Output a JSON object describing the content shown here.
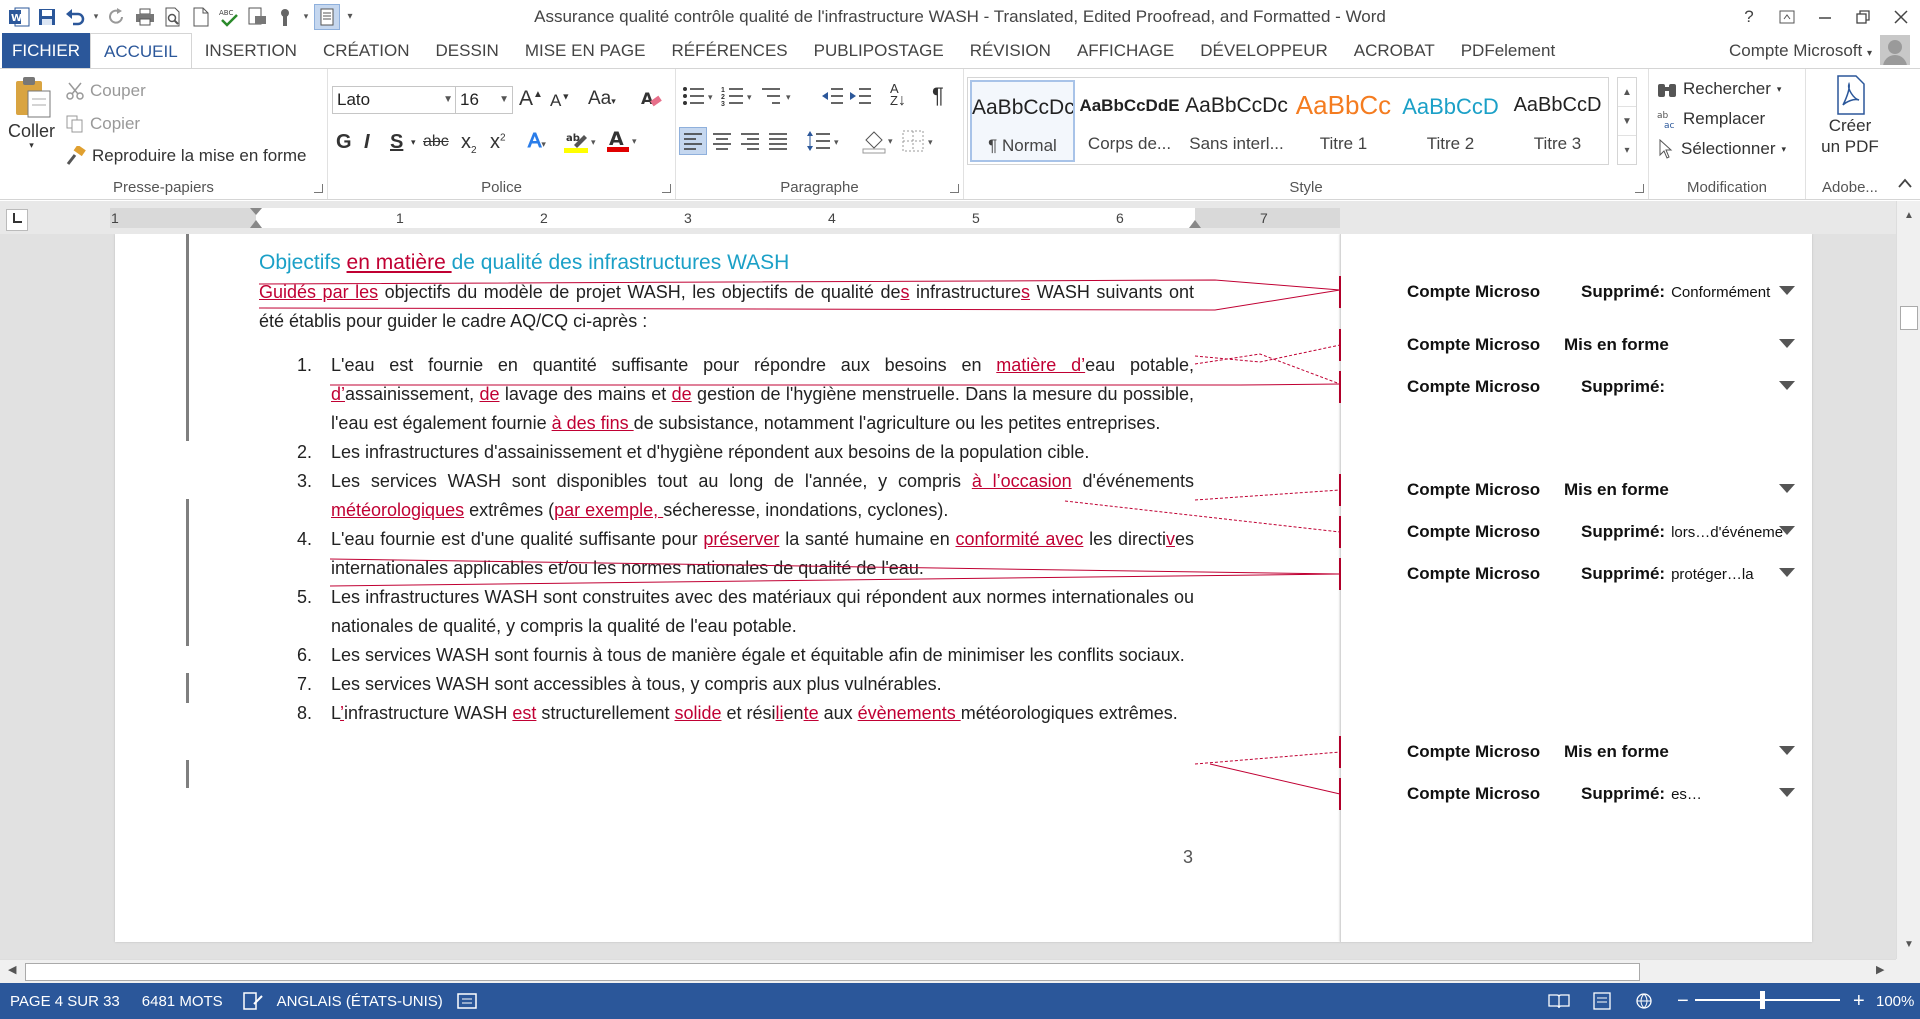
{
  "window": {
    "title": "Assurance qualité  contrôle qualité de l'infrastructure WASH - Translated, Edited Proofread, and Formatted - Word",
    "help": "?",
    "accent": "#2b579a"
  },
  "tabs": {
    "file": "FICHIER",
    "items": [
      "ACCUEIL",
      "INSERTION",
      "CRÉATION",
      "DESSIN",
      "MISE EN PAGE",
      "RÉFÉRENCES",
      "PUBLIPOSTAGE",
      "RÉVISION",
      "AFFICHAGE",
      "DÉVELOPPEUR",
      "ACROBAT",
      "PDFelement"
    ],
    "active_index": 0,
    "account": "Compte Microsoft"
  },
  "ribbon": {
    "clipboard": {
      "paste": "Coller",
      "cut": "Couper",
      "copy": "Copier",
      "format_painter": "Reproduire la mise en forme",
      "label": "Presse-papiers"
    },
    "font": {
      "name": "Lato",
      "size": "16",
      "label": "Police"
    },
    "paragraph": {
      "label": "Paragraphe"
    },
    "styles": {
      "label": "Style",
      "items": [
        {
          "preview": "AaBbCcDc",
          "name": "¶ Normal",
          "color": "#222222"
        },
        {
          "preview": "AaBbCcDdE",
          "name": "Corps de...",
          "color": "#222222"
        },
        {
          "preview": "AaBbCcDc",
          "name": "Sans interl...",
          "color": "#222222"
        },
        {
          "preview": "AaBbCc",
          "name": "Titre 1",
          "color": "#f47c20"
        },
        {
          "preview": "AaBbCcD",
          "name": "Titre 2",
          "color": "#1ba0c7"
        },
        {
          "preview": "AaBbCcD",
          "name": "Titre 3",
          "color": "#222222"
        }
      ]
    },
    "editing": {
      "find": "Rechercher",
      "replace": "Remplacer",
      "select": "Sélectionner",
      "label": "Modification"
    },
    "adobe": {
      "create_line1": "Créer",
      "create_line2": "un PDF",
      "label": "Adobe..."
    }
  },
  "ruler": {
    "numbers": [
      "1",
      "1",
      "2",
      "3",
      "4",
      "5",
      "6",
      "7"
    ]
  },
  "document": {
    "heading": {
      "a": "Objectifs ",
      "ins": "en matière ",
      "b": "de qualité des infrastructures WASH"
    },
    "intro": {
      "ins1": "Guidés par les",
      "t1": " objectifs du modèle de projet WASH, les objectifs de qualité de",
      "ins2": "s",
      "t2": " infrastructure",
      "ins3": "s",
      "t3": " WASH suivants ont été établis pour guider le cadre AQ/CQ ci-après :"
    },
    "items": [
      {
        "n": "1.",
        "parts": [
          {
            "t": "L'eau est fournie en quantité suffisante pour répondre aux besoins en "
          },
          {
            "t": "matière d’",
            "ins": true
          },
          {
            "t": "eau potable, "
          },
          {
            "t": "d’",
            "ins": true
          },
          {
            "t": "assainissement, "
          },
          {
            "t": "de",
            "ins": true
          },
          {
            "t": " lavage des mains et "
          },
          {
            "t": "de",
            "ins": true
          },
          {
            "t": " gestion de l'hygiène menstruelle. Dans la mesure du possible, l'eau est également fournie "
          },
          {
            "t": "à des fins ",
            "ins": true
          },
          {
            "t": "de subsistance, notamment l'agriculture ou les petites entreprises."
          }
        ]
      },
      {
        "n": "2.",
        "parts": [
          {
            "t": "Les infrastructures d'assainissement et d'hygiène répondent aux besoins de la population cible."
          }
        ]
      },
      {
        "n": "3.",
        "parts": [
          {
            "t": "Les services WASH sont disponibles tout au long de l'année, y compris "
          },
          {
            "t": "à l’occasion",
            "ins": true
          },
          {
            "t": " d'événements "
          },
          {
            "t": "météorologiques",
            "ins": true
          },
          {
            "t": " extrêmes ("
          },
          {
            "t": "par exemple, ",
            "ins": true
          },
          {
            "t": "sécheresse, inondations, cyclones)."
          }
        ]
      },
      {
        "n": "4.",
        "parts": [
          {
            "t": "L'eau fournie est d'une qualité suffisante pour "
          },
          {
            "t": "préserver",
            "ins": true
          },
          {
            "t": " la santé humaine en "
          },
          {
            "t": "conformité avec",
            "ins": true
          },
          {
            "t": " les directi"
          },
          {
            "t": "v",
            "ins": true
          },
          {
            "t": "es internationales applicables et/ou les normes nationales de qualité de l'eau."
          }
        ]
      },
      {
        "n": "5.",
        "parts": [
          {
            "t": "Les infrastructures WASH sont construites avec des matériaux qui répondent aux normes internationales ou nationales de qualité, y compris la qualité de l'eau potable."
          }
        ]
      },
      {
        "n": "6.",
        "parts": [
          {
            "t": "Les services WASH sont fournis à tous de manière égale et équitable afin de minimiser les conflits sociaux."
          }
        ]
      },
      {
        "n": "7.",
        "parts": [
          {
            "t": "Les services WASH sont accessibles à tous, y compris aux plus vulnérables."
          }
        ]
      },
      {
        "n": "8.",
        "parts": [
          {
            "t": "L"
          },
          {
            "t": "’",
            "ins": true
          },
          {
            "t": "infrastructure WASH "
          },
          {
            "t": "est",
            "ins": true
          },
          {
            "t": " structurellement "
          },
          {
            "t": "solide",
            "ins": true
          },
          {
            "t": " et rési"
          },
          {
            "t": "li",
            "ins": true
          },
          {
            "t": "en"
          },
          {
            "t": "t",
            "ins": true
          },
          {
            "t": "e",
            "ins": true
          },
          {
            "t": " aux "
          },
          {
            "t": "évènements ",
            "ins": true
          },
          {
            "t": "météorologiques extrêmes."
          }
        ]
      }
    ],
    "page_number": "3"
  },
  "comments": [
    {
      "author": "Compte Microso",
      "action": "Supprimé:",
      "detail": "Conformément"
    },
    {
      "author": "Compte Microso",
      "action": "Mis en forme",
      "detail": ""
    },
    {
      "author": "Compte Microso",
      "action": "Supprimé:",
      "detail": ""
    },
    {
      "author": "Compte Microso",
      "action": "Mis en forme",
      "detail": ""
    },
    {
      "author": "Compte Microso",
      "action": "Supprimé:",
      "detail": "lors…d'événeme"
    },
    {
      "author": "Compte Microso",
      "action": "Supprimé:",
      "detail": "protéger…la"
    },
    {
      "author": "Compte Microso",
      "action": "Mis en forme",
      "detail": ""
    },
    {
      "author": "Compte Microso",
      "action": "Supprimé:",
      "detail": "es…"
    }
  ],
  "status": {
    "page": "PAGE 4 SUR 33",
    "words": "6481 MOTS",
    "language": "ANGLAIS (ÉTATS-UNIS)",
    "zoom_minus": "−",
    "zoom_plus": "+",
    "zoom": "100%"
  },
  "colors": {
    "insertion": "#c00033",
    "heading": "#1ba0c7",
    "statusbar": "#2b579a"
  }
}
